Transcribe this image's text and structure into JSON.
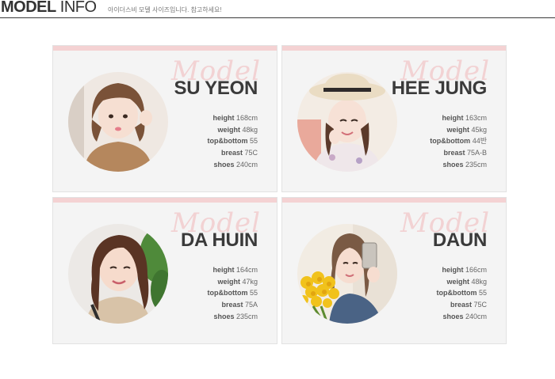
{
  "header": {
    "title_bold": "MODEL",
    "title_light": "INFO",
    "subtitle": "아이더스비 모델 사이즈입니다. 참고하세요!"
  },
  "models": [
    {
      "script": "Model",
      "name": "SU YEON",
      "height": "168cm",
      "weight": "48kg",
      "topbottom": "55",
      "breast": "75C",
      "shoes": "240cm"
    },
    {
      "script": "Model",
      "name": "HEE JUNG",
      "height": "163cm",
      "weight": "45kg",
      "topbottom": "44반",
      "breast": "75A-B",
      "shoes": "235cm"
    },
    {
      "script": "Model",
      "name": "DA HUIN",
      "height": "164cm",
      "weight": "47kg",
      "topbottom": "55",
      "breast": "75A",
      "shoes": "235cm"
    },
    {
      "script": "Model",
      "name": "DAUN",
      "height": "166cm",
      "weight": "48kg",
      "topbottom": "55",
      "breast": "75C",
      "shoes": "240cm"
    }
  ],
  "labels": {
    "height": "height",
    "weight": "weight",
    "topbottom": "top&bottom",
    "breast": "breast",
    "shoes": "shoes"
  }
}
